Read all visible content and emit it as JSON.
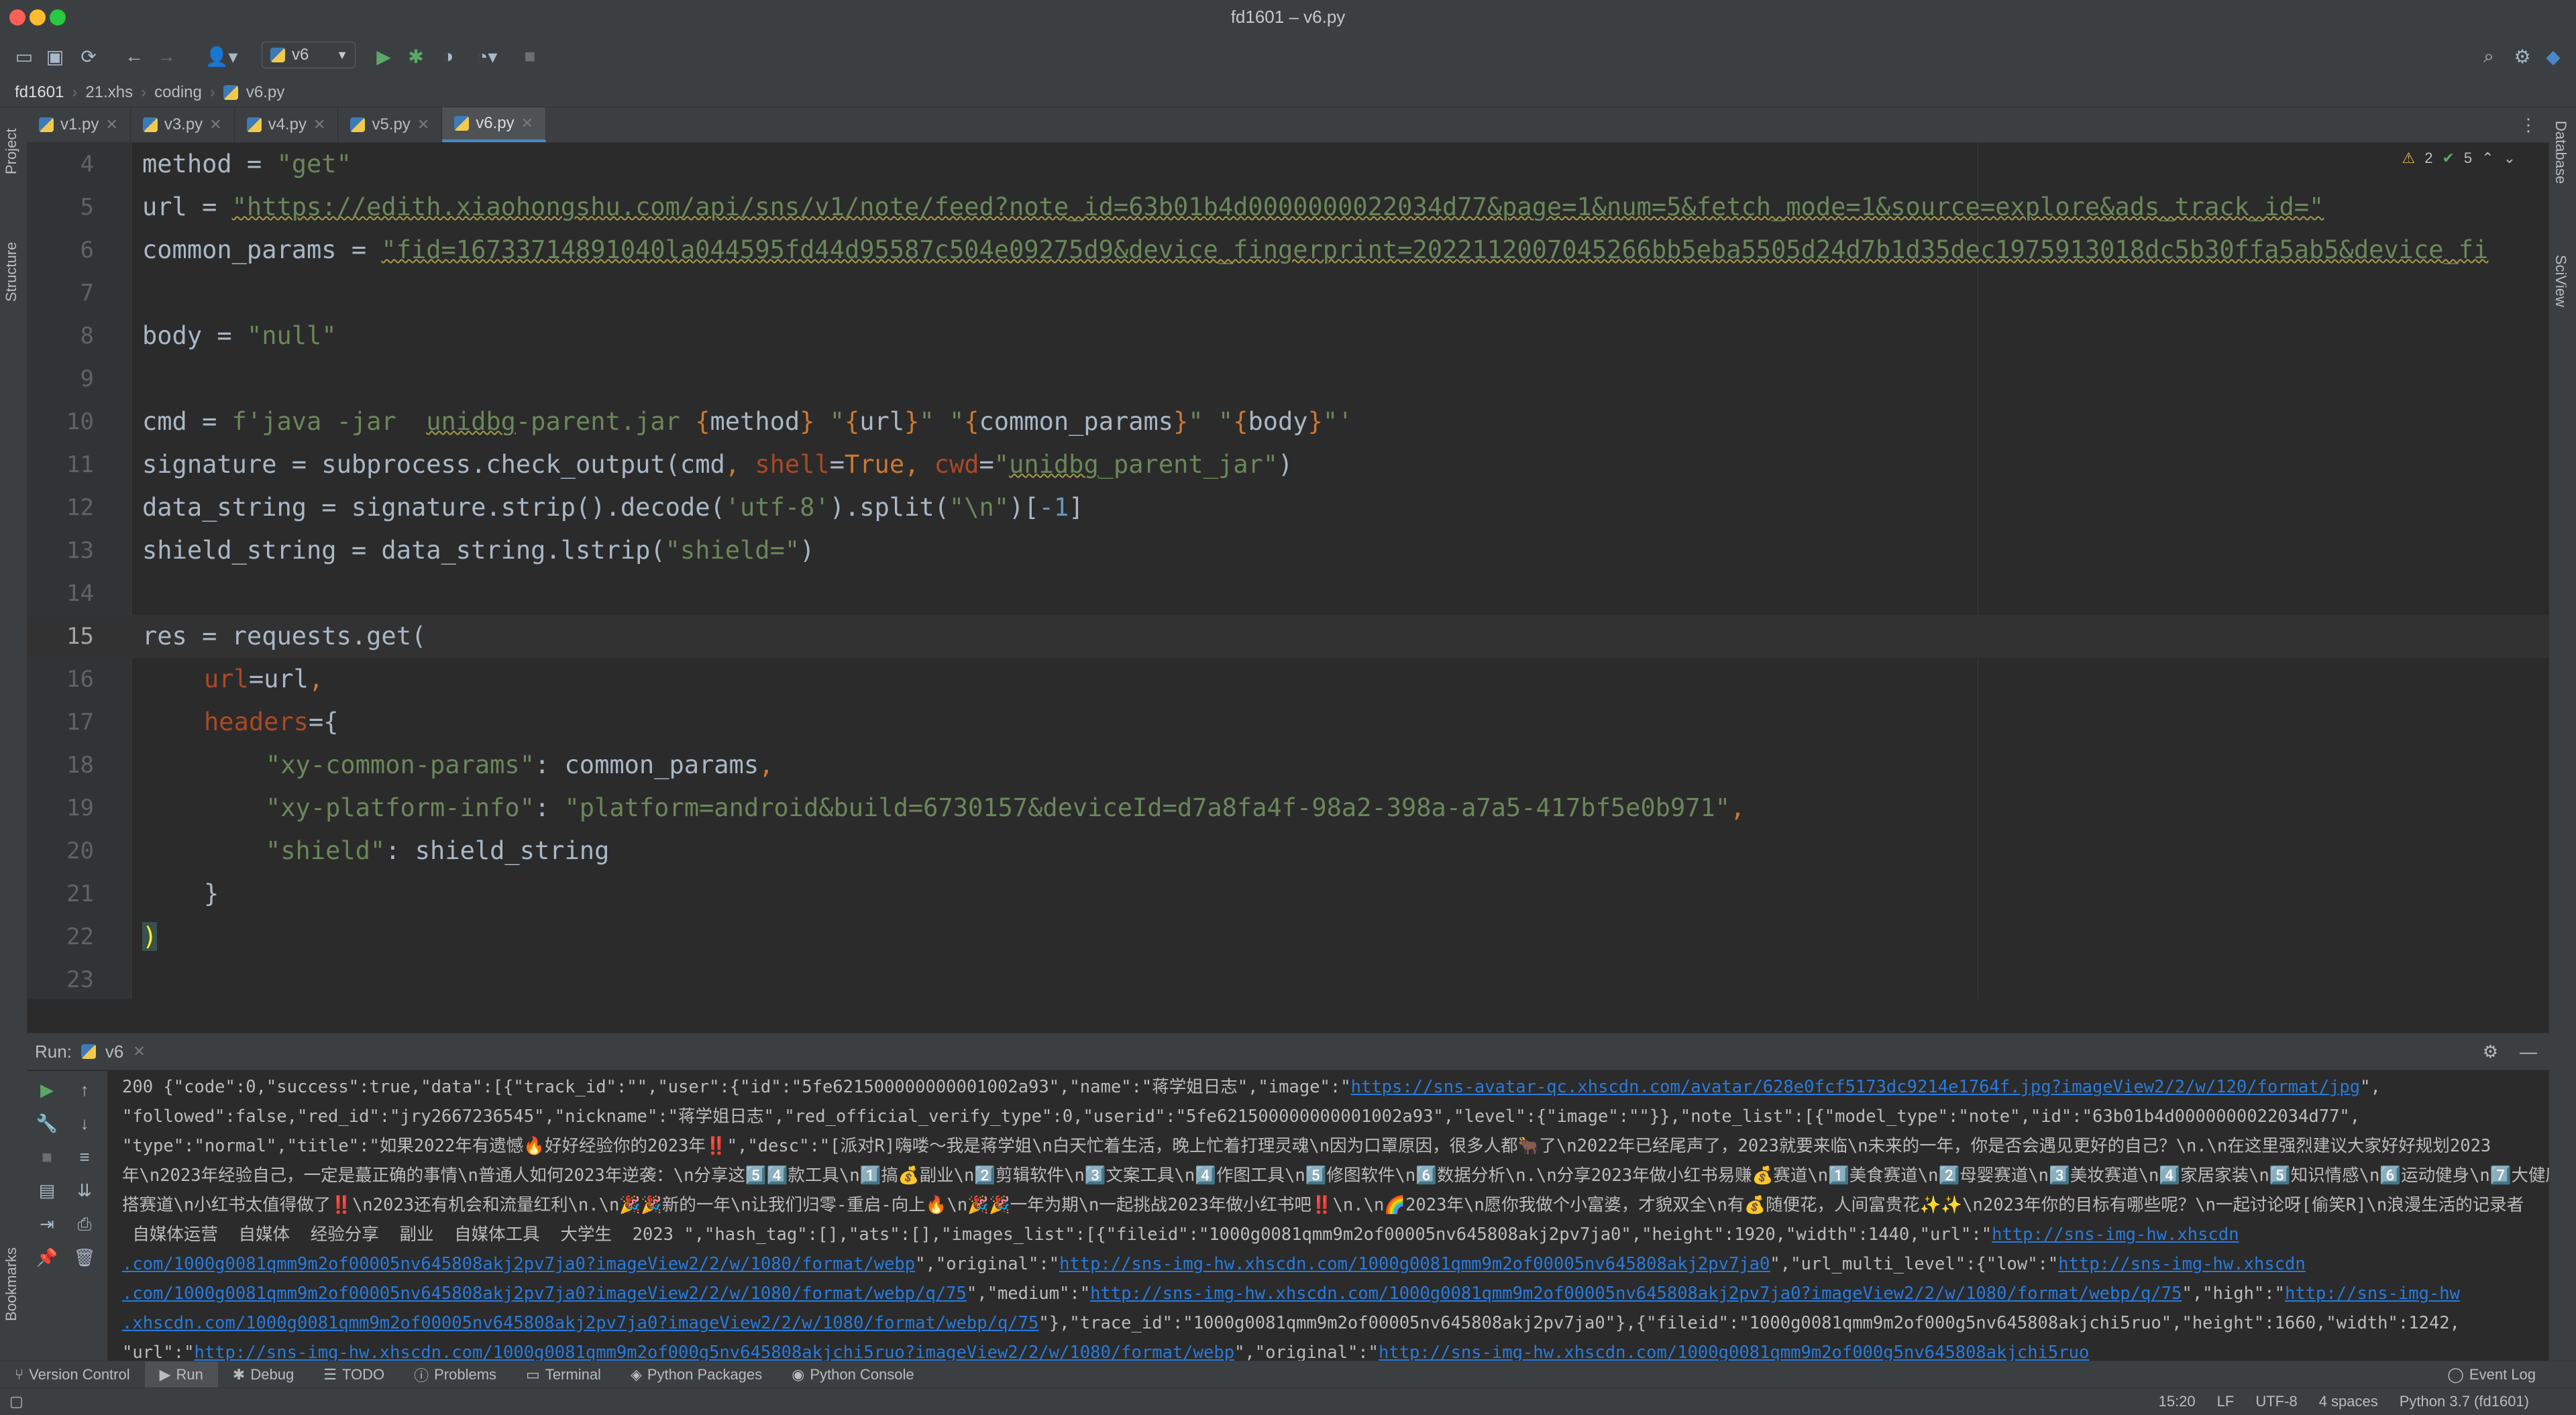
{
  "window": {
    "title": "fd1601 – v6.py"
  },
  "toolbar": {
    "run_config": "v6"
  },
  "breadcrumb": [
    "fd1601",
    "21.xhs",
    "coding",
    "v6.py"
  ],
  "left_strip": {
    "project": "Project",
    "structure": "Structure",
    "bookmarks": "Bookmarks"
  },
  "right_strip": {
    "database": "Database",
    "sciview": "SciView"
  },
  "tabs": [
    {
      "label": "v1.py",
      "active": false
    },
    {
      "label": "v3.py",
      "active": false
    },
    {
      "label": "v4.py",
      "active": false
    },
    {
      "label": "v5.py",
      "active": false
    },
    {
      "label": "v6.py",
      "active": true
    }
  ],
  "inspections": {
    "warnings": "2",
    "ok": "5"
  },
  "code": {
    "l4": {
      "num": "4",
      "a": "method",
      "b": " = ",
      "c": "\"get\""
    },
    "l5": {
      "num": "5",
      "a": "url",
      "b": " = ",
      "c": "\"https://edith.xiaohongshu.com/api/sns/v1/note/feed?note_id=63b01b4d0000000022034d77&page=1&num=5&fetch_mode=1&source=explore&ads_track_id=\""
    },
    "l6": {
      "num": "6",
      "a": "common_params",
      "b": " = ",
      "c": "\"fid=16733714891040la044595fd44d95587c504e09275d9&device_fingerprint=20221120070452​66bb5eba5505d24d7b1d35dec1975913018dc5b30ffa5ab5&device_fi"
    },
    "l7": {
      "num": "7"
    },
    "l8": {
      "num": "8",
      "a": "body",
      "b": " = ",
      "c": "\"null\""
    },
    "l9": {
      "num": "9"
    },
    "l10": {
      "num": "10",
      "a": "cmd",
      "b": " = ",
      "c1": "f'java -jar  ",
      "c2": "unidbg",
      "c3": "-parent.jar ",
      "d1": "{",
      "d2": "method",
      "d3": "}",
      "e1": " \"",
      "e2": "{",
      "e3": "url",
      "e4": "}",
      "e5": "\" \"",
      "e6": "{",
      "e7": "common_params",
      "e8": "}",
      "e9": "\" \"",
      "e10": "{",
      "e11": "body",
      "e12": "}",
      "e13": "\"'"
    },
    "l11": {
      "num": "11",
      "a": "signature = subprocess.check_output(cmd",
      "b": ", ",
      "c": "shell",
      "d": "=",
      "e": "True",
      "f": ", ",
      "g": "cwd",
      "h": "=",
      "i": "\"",
      "j": "unidbg",
      "k": "_parent_jar\"",
      "l": ")"
    },
    "l12": {
      "num": "12",
      "a": "data_string = signature.strip().decode(",
      "b": "'utf-8'",
      "c": ").split(",
      "d": "\"\\n\"",
      "e": ")[",
      "f": "-1",
      "g": "]"
    },
    "l13": {
      "num": "13",
      "a": "shield_string = data_string.lstrip(",
      "b": "\"shield=\"",
      "c": ")"
    },
    "l14": {
      "num": "14"
    },
    "l15": {
      "num": "15",
      "a": "res = requests.get("
    },
    "l16": {
      "num": "16",
      "a": "url",
      "b": "=url",
      "c": ","
    },
    "l17": {
      "num": "17",
      "a": "headers",
      "b": "={"
    },
    "l18": {
      "num": "18",
      "a": "\"xy-common-params\"",
      "b": ": common_params",
      "c": ","
    },
    "l19": {
      "num": "19",
      "a": "\"xy-platform-info\"",
      "b": ": ",
      "c": "\"platform=android&build=6730157&deviceId=d7a8fa4f-98a2-398a-a7a5-417bf5e0b971\"",
      "d": ","
    },
    "l20": {
      "num": "20",
      "a": "\"shield\"",
      "b": ": shield_string"
    },
    "l21": {
      "num": "21",
      "a": "}"
    },
    "l22": {
      "num": "22",
      "a": ")"
    },
    "l23": {
      "num": "23"
    }
  },
  "run": {
    "title": "Run:",
    "tab": "v6",
    "lines": {
      "c1a": "200 {\"code\":0,\"success\":true,\"data\":[{\"track_id\":\"\",\"user\":{\"id\":\"5fe621500000000001002a93\",\"name\":\"蒋学姐日志\",\"image\":\"",
      "c1b": "https://sns-avatar-qc.xhscdn.com/avatar/628e0fcf5173dc9214e1764f.jpg?imageView2/2/w/120/format/jpg",
      "c1c": "\",",
      "c2": "\"followed\":false,\"red_id\":\"jry2667236545\",\"nickname\":\"蒋学姐日志\",\"red_official_verify_type\":0,\"userid\":\"5fe621500000000001002a93\",\"level\":{\"image\":\"\"}},\"note_list\":[{\"model_type\":\"note\",\"id\":\"63b01b4d0000000022034d77\",",
      "c3": "\"type\":\"normal\",\"title\":\"如果2022年有遗憾🔥好好经验你的2023年‼️\",\"desc\":\"[派对R]嗨喽～我是蒋学姐\\n白天忙着生活，晚上忙着打理灵魂\\n因为口罩原因，很多人都🐂了\\n2022年已经尾声了，2023就要来临\\n未来的一年，你是否会遇见更好的自己？\\n.\\n在这里强烈建议大家好好规划2023",
      "c4": "年\\n2023年经验自己，一定是蕞正确的事情\\n普通人如何2023年逆袭：\\n分享这5️⃣4️⃣款工具\\n1️⃣搞💰副业\\n2️⃣剪辑软件\\n3️⃣文案工具\\n4️⃣作图工具\\n5️⃣修图软件\\n6️⃣数据分析\\n.\\n分享2023年做小红书易赚💰赛道\\n1️⃣美食赛道\\n2️⃣母婴赛道\\n3️⃣美妆赛道\\n4️⃣家居家装\\n5️⃣知识情感\\n6️⃣运动健身\\n7️⃣大健康",
      "c5": "搭赛道\\n小红书太值得做了‼️\\n2023还有机会和流量红利\\n.\\n🎉🎉新的一年\\n让我们归零-重启-向上🔥\\n🎉🎉一年为期\\n一起挑战2023年做小红书吧‼️\\n.\\n🌈2023年\\n愿你我做个小富婆，才貌双全\\n有💰随便花，人间富贵花✨✨\\n2023年你的目标有哪些呢？\\n一起讨论呀[偷笑R]\\n浪漫生活的记录者",
      "c6a": " 自媒体运营  自媒体  经验分享  副业  自媒体工具  大学生  2023 \",\"hash_tag\":[],\"ats\":[],\"images_list\":[{\"fileid\":\"1000g0081qmm9m2of00005nv645808akj2pv7ja0\",\"height\":1920,\"width\":1440,\"url\":\"",
      "c6b": "http://sns-img-hw.xhscdn",
      "c7a": ".com/1000g0081qmm9m2of00005nv645808akj2pv7ja0?imageView2/2/w/1080/format/webp",
      "c7b": "\",\"original\":\"",
      "c7c": "http://sns-img-hw.xhscdn.com/1000g0081qmm9m2of00005nv645808akj2pv7ja0",
      "c7d": "\",\"url_multi_level\":{\"low\":\"",
      "c7e": "http://sns-img-hw.xhscdn",
      "c8a": ".com/1000g0081qmm9m2of00005nv645808akj2pv7ja0?imageView2/2/w/1080/format/webp/q/75",
      "c8b": "\",\"medium\":\"",
      "c8c": "http://sns-img-hw.xhscdn.com/1000g0081qmm9m2of00005nv645808akj2pv7ja0?imageView2/2/w/1080/format/webp/q/75",
      "c8d": "\",\"high\":\"",
      "c8e": "http://sns-img-hw",
      "c9a": ".xhscdn.com/1000g0081qmm9m2of00005nv645808akj2pv7ja0?imageView2/2/w/1080/format/webp/q/75",
      "c9b": "\"},\"trace_id\":\"1000g0081qmm9m2of00005nv645808akj2pv7ja0\"},{\"fileid\":\"1000g0081qmm9m2of000g5nv645808akjchi5ruo\",\"height\":1660,\"width\":1242,",
      "c10a": "\"url\":\"",
      "c10b": "http://sns-img-hw.xhscdn.com/1000g0081qmm9m2of000g5nv645808akjchi5ruo?imageView2/2/w/1080/format/webp",
      "c10c": "\",\"original\":\"",
      "c10d": "http://sns-img-hw.xhscdn.com/1000g0081qmm9m2of000g5nv645808akjchi5ruo"
    }
  },
  "bottom_tabs": [
    "Version Control",
    "Run",
    "Debug",
    "TODO",
    "Problems",
    "Terminal",
    "Python Packages",
    "Python Console"
  ],
  "event_log": "Event Log",
  "status": {
    "position": "15:20",
    "line_sep": "LF",
    "encoding": "UTF-8",
    "indent": "4 spaces",
    "interpreter": "Python 3.7 (fd1601)"
  }
}
